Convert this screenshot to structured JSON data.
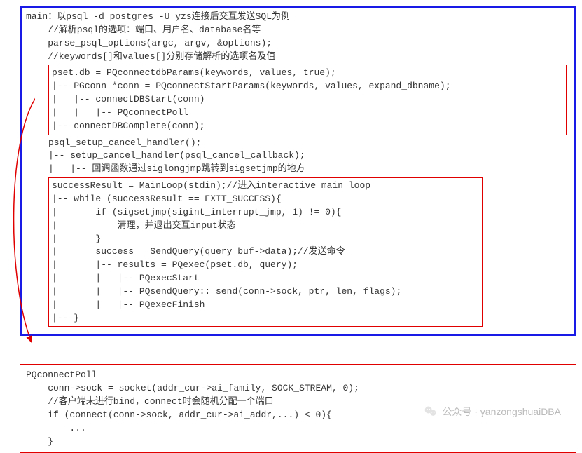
{
  "top": {
    "l1": "main：以psql -d postgres -U yzs连接后交互发送SQL为例",
    "l2": "    //解析psql的选项：端口、用户名、database名等",
    "l3": "    parse_psql_options(argc, argv, &options);",
    "l4": "    //keywords[]和values[]分别存储解析的选项名及值",
    "box1_l1": "pset.db = PQconnectdbParams(keywords, values, true);",
    "box1_l2": "|-- PGconn *conn = PQconnectStartParams(keywords, values, expand_dbname);",
    "box1_l3": "|   |-- connectDBStart(conn)",
    "box1_l4": "|   |   |-- PQconnectPoll",
    "box1_l5": "|-- connectDBComplete(conn);",
    "mid_l1": "psql_setup_cancel_handler();",
    "mid_l2": "|-- setup_cancel_handler(psql_cancel_callback);",
    "mid_l3": "|   |-- 回调函数通过siglongjmp跳转到sigsetjmp的地方",
    "box2_l1": "successResult = MainLoop(stdin);//进入interactive main loop",
    "box2_l2": "|-- while (successResult == EXIT_SUCCESS){",
    "box2_l3": "|       if (sigsetjmp(sigint_interrupt_jmp, 1) != 0){",
    "box2_l4": "|           清理，并退出交互input状态",
    "box2_l5": "|       }",
    "box2_l6": "|       success = SendQuery(query_buf->data);//发送命令",
    "box2_l7": "|       |-- results = PQexec(pset.db, query);",
    "box2_l8": "|       |   |-- PQexecStart",
    "box2_l9": "|       |   |-- PQsendQuery:: send(conn->sock, ptr, len, flags);",
    "box2_l10": "|       |   |-- PQexecFinish",
    "box2_l11": "|-- }"
  },
  "bottom": {
    "l1": "PQconnectPoll",
    "l2": "    conn->sock = socket(addr_cur->ai_family, SOCK_STREAM, 0);",
    "l3": "    //客户端未进行bind，connect时会随机分配一个端口",
    "l4": "    if (connect(conn->sock, addr_cur->ai_addr,...) < 0){",
    "l5": "        ...",
    "l6": "    }"
  },
  "watermark": {
    "text": "公众号 · yanzongshuaiDBA"
  }
}
